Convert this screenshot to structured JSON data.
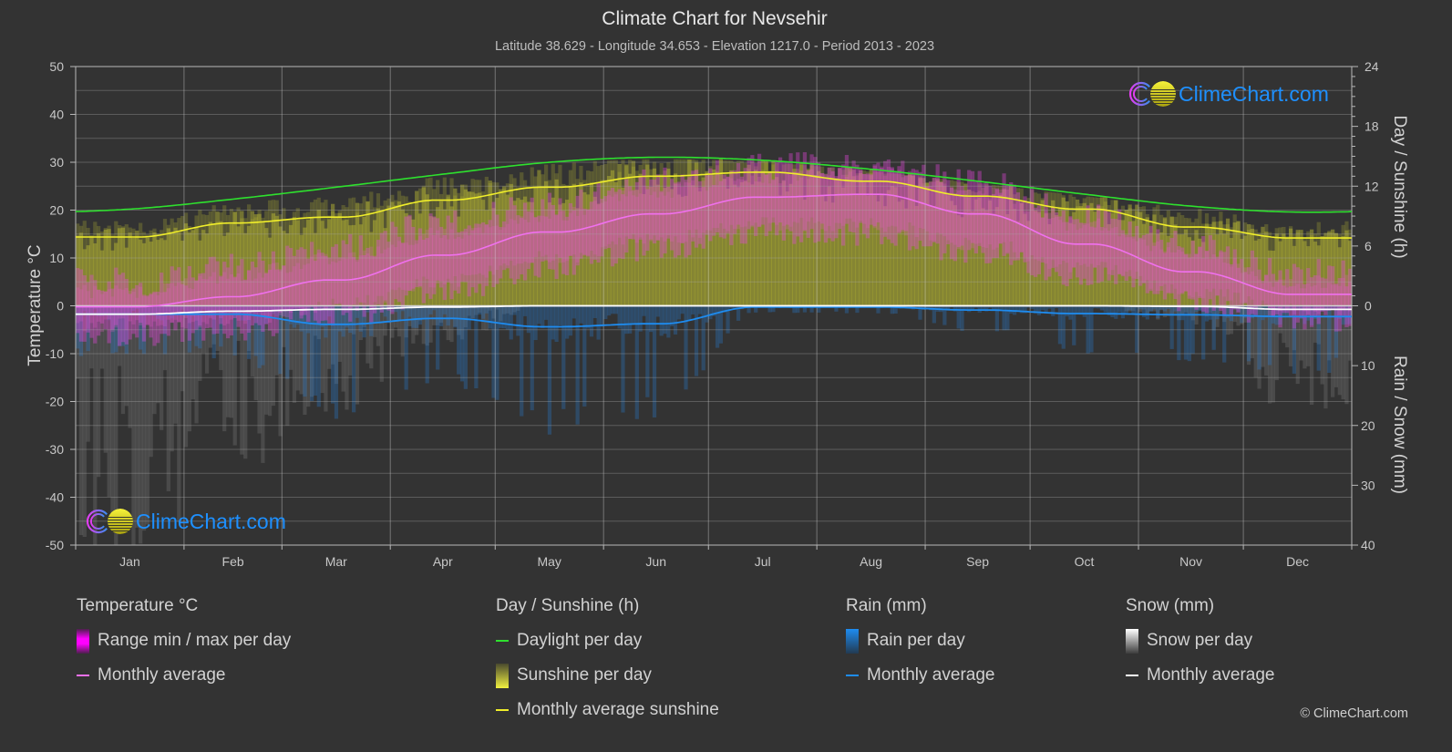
{
  "chart_data": {
    "type": "line",
    "title": "Climate Chart for Nevsehir",
    "subtitle": "Latitude 38.629 - Longitude 34.653 - Elevation 1217.0 - Period 2013 - 2023",
    "categories": [
      "Jan",
      "Feb",
      "Mar",
      "Apr",
      "May",
      "Jun",
      "Jul",
      "Aug",
      "Sep",
      "Oct",
      "Nov",
      "Dec"
    ],
    "axes": {
      "left": {
        "label": "Temperature °C",
        "range": [
          -50,
          50
        ],
        "ticks": [
          50,
          40,
          30,
          20,
          10,
          0,
          -10,
          -20,
          -30,
          -40,
          -50
        ]
      },
      "right_top": {
        "label": "Day / Sunshine (h)",
        "range": [
          0,
          24
        ],
        "ticks": [
          24,
          18,
          12,
          6,
          0
        ]
      },
      "right_bottom": {
        "label": "Rain / Snow (mm)",
        "range": [
          0,
          40
        ],
        "ticks": [
          10,
          20,
          30,
          40
        ]
      }
    },
    "grid": true,
    "legend_position": "bottom",
    "series": [
      {
        "id": "temp_range",
        "name": "Range min / max per day",
        "type": "band",
        "axis": "left",
        "unit": "°C",
        "color": "#e646dc",
        "min": [
          -6,
          -5,
          -2,
          3,
          8,
          12,
          15,
          15,
          11,
          6,
          1,
          -3
        ],
        "max": [
          5,
          8,
          12,
          17,
          21,
          26,
          29,
          30,
          26,
          19,
          13,
          7
        ]
      },
      {
        "id": "temp_avg",
        "name": "Temperature monthly average",
        "type": "line",
        "axis": "left",
        "unit": "°C",
        "color": "#f070ee",
        "values": [
          -0.2,
          1.9,
          5.4,
          10.6,
          15.4,
          19.2,
          22.7,
          23.3,
          19.2,
          12.9,
          7.1,
          2.4
        ]
      },
      {
        "id": "daylight",
        "name": "Daylight per day",
        "type": "line",
        "axis": "right_top",
        "unit": "h",
        "color": "#2ee02e",
        "values": [
          9.7,
          10.7,
          11.9,
          13.2,
          14.4,
          14.9,
          14.6,
          13.7,
          12.5,
          11.2,
          10.0,
          9.4
        ]
      },
      {
        "id": "sunshine",
        "name": "Monthly average sunshine",
        "type": "line",
        "axis": "right_top",
        "unit": "h",
        "color": "#f0ee2a",
        "values": [
          6.9,
          8.3,
          8.9,
          10.6,
          11.9,
          13.0,
          13.4,
          12.5,
          11.0,
          9.7,
          7.9,
          6.8
        ]
      },
      {
        "id": "rain",
        "name": "Rain monthly average",
        "type": "line",
        "axis": "right_bottom",
        "unit": "mm",
        "color": "#1e8cf0",
        "values": [
          1.4,
          1.4,
          3.1,
          2.1,
          3.5,
          3.0,
          0.2,
          0.2,
          0.7,
          1.3,
          1.5,
          1.8
        ]
      },
      {
        "id": "snow",
        "name": "Snow monthly average",
        "type": "line",
        "axis": "right_bottom",
        "unit": "mm",
        "color": "#ffffff",
        "values": [
          1.4,
          0.9,
          0.6,
          0.2,
          0,
          0,
          0,
          0,
          0,
          0,
          0.1,
          0.6
        ]
      }
    ],
    "legend": [
      {
        "title": "Temperature °C",
        "items": [
          {
            "label": "Range min / max per day",
            "color": "#ff00ff"
          },
          {
            "label": "Monthly average",
            "color": "#f070ee"
          }
        ]
      },
      {
        "title": "Day / Sunshine (h)",
        "items": [
          {
            "label": "Daylight per day",
            "color": "#2ee02e"
          },
          {
            "label": "Sunshine per day",
            "color": "#f0f040"
          },
          {
            "label": "Monthly average sunshine",
            "color": "#f0ee2a"
          }
        ]
      },
      {
        "title": "Rain (mm)",
        "items": [
          {
            "label": "Rain per day",
            "color": "#1e8cf0"
          },
          {
            "label": "Monthly average",
            "color": "#1e8cf0"
          }
        ]
      },
      {
        "title": "Snow (mm)",
        "items": [
          {
            "label": "Snow per day",
            "color": "#ffffff"
          },
          {
            "label": "Monthly average",
            "color": "#ffffff"
          }
        ]
      }
    ]
  },
  "branding": {
    "logo_text": "ClimeChart.com",
    "logo_text_color": "#1e90ff",
    "copyright": "© ClimeChart.com"
  }
}
